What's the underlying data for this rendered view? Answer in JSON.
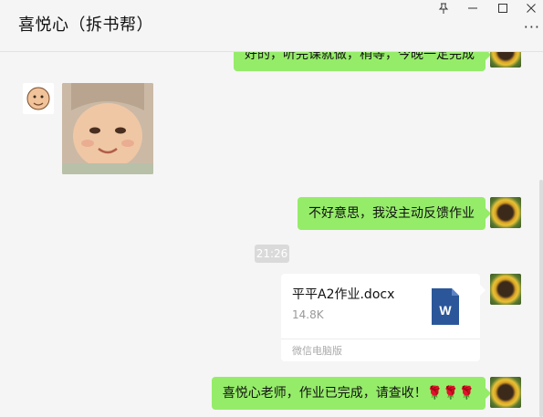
{
  "window": {
    "title": "喜悦心（拆书帮）",
    "controls": {
      "pin": "⊥",
      "minimize": "—",
      "maximize": "□",
      "close": "✕"
    },
    "more": "···"
  },
  "messages": [
    {
      "sender": "me",
      "type": "text",
      "text": "好的，听完课就做，稍等，今晚一定完成"
    },
    {
      "sender": "other",
      "type": "sticker",
      "sticker": "baby-smile-sticker"
    },
    {
      "sender": "me",
      "type": "text",
      "text": "不好意思，我没主动反馈作业"
    },
    {
      "type": "time",
      "text": "21:26"
    },
    {
      "sender": "me",
      "type": "file",
      "file_name": "平平A2作业.docx",
      "file_size": "14.8K",
      "source": "微信电脑版",
      "icon_letter": "W"
    },
    {
      "sender": "me",
      "type": "text",
      "text": "喜悦心老师，作业已完成，请查收！🌹🌹🌹"
    }
  ],
  "colors": {
    "my_bubble": "#95ec69",
    "background": "#f5f5f5",
    "word_blue": "#2b579a"
  }
}
